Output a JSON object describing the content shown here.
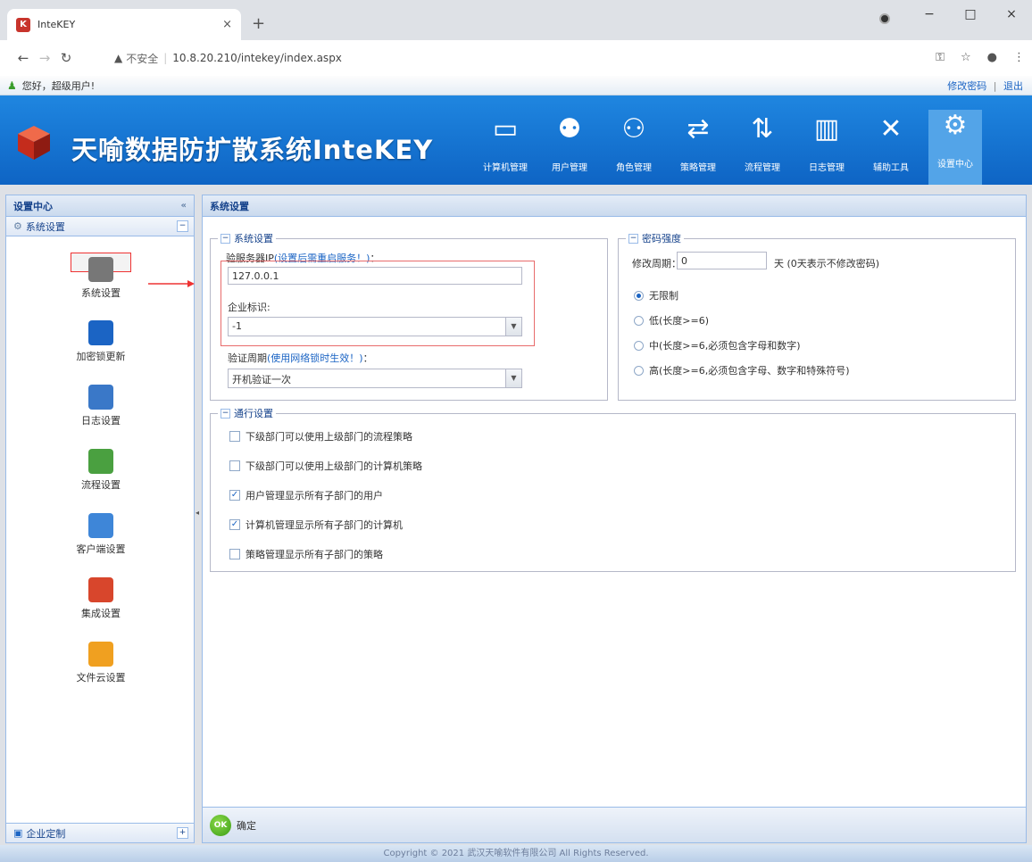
{
  "browser": {
    "tab_title": "InteKEY",
    "tab_close": "×",
    "new_tab": "+",
    "security_label": "不安全",
    "url": "10.8.20.210/intekey/index.aspx",
    "win_min": "−",
    "win_max": "□",
    "win_close": "×"
  },
  "userbar": {
    "greeting": "您好，超级用户!",
    "change_password": "修改密码",
    "separator": "|",
    "logout": "退出"
  },
  "banner": {
    "brand": "天喻数据防扩散系统InteKEY",
    "nav": [
      {
        "label": "计算机管理",
        "icon": "monitor-icon"
      },
      {
        "label": "用户管理",
        "icon": "users-icon"
      },
      {
        "label": "角色管理",
        "icon": "roles-icon"
      },
      {
        "label": "策略管理",
        "icon": "policy-icon"
      },
      {
        "label": "流程管理",
        "icon": "workflow-icon"
      },
      {
        "label": "日志管理",
        "icon": "log-book-icon"
      },
      {
        "label": "辅助工具",
        "icon": "tools-icon"
      },
      {
        "label": "设置中心",
        "icon": "gears-icon"
      }
    ]
  },
  "left": {
    "header": "设置中心",
    "header_tool": "«",
    "section": "系统设置",
    "section_tool": "−",
    "items": [
      {
        "label": "系统设置",
        "icon": "system-settings-icon"
      },
      {
        "label": "加密锁更新",
        "icon": "lock-icon"
      },
      {
        "label": "日志设置",
        "icon": "log-settings-icon"
      },
      {
        "label": "流程设置",
        "icon": "workflow-settings-icon"
      },
      {
        "label": "客户端设置",
        "icon": "client-settings-icon"
      },
      {
        "label": "集成设置",
        "icon": "integration-settings-icon"
      },
      {
        "label": "文件云设置",
        "icon": "file-cloud-icon"
      }
    ],
    "bottom_section": "企业定制",
    "bottom_tool": "+"
  },
  "main": {
    "header": "系统设置",
    "system": {
      "legend": "系统设置",
      "server_ip_label": "验服务器IP",
      "server_ip_note": "(设置后需重启服务！)",
      "server_ip_suffix": "：",
      "server_ip_value": "127.0.0.1",
      "enterprise_label": "企业标识:",
      "enterprise_value": "-1",
      "verify_label": "验证周期",
      "verify_note": "(使用网络锁时生效！)",
      "verify_suffix": "：",
      "verify_value": "开机验证一次"
    },
    "password": {
      "legend": "密码强度",
      "period_label": "修改周期：",
      "period_value": "0",
      "period_unit": "天  (0天表示不修改密码)",
      "options": [
        {
          "label": "无限制",
          "checked": true
        },
        {
          "label": "低(长度>=6)",
          "checked": false
        },
        {
          "label": "中(长度>=6,必须包含字母和数字)",
          "checked": false
        },
        {
          "label": "高(长度>=6,必须包含字母、数字和特殊符号)",
          "checked": false
        }
      ]
    },
    "advanced": {
      "legend": "通行设置",
      "options": [
        {
          "label": "下级部门可以使用上级部门的流程策略",
          "checked": false
        },
        {
          "label": "下级部门可以使用上级部门的计算机策略",
          "checked": false
        },
        {
          "label": "用户管理显示所有子部门的用户",
          "checked": true
        },
        {
          "label": "计算机管理显示所有子部门的计算机",
          "checked": true
        },
        {
          "label": "策略管理显示所有子部门的策略",
          "checked": false
        }
      ]
    },
    "ok_icon": "OK",
    "ok_label": "确定"
  },
  "footer": "Copyright © 2021 武汉天喻软件有限公司 All Rights Reserved."
}
